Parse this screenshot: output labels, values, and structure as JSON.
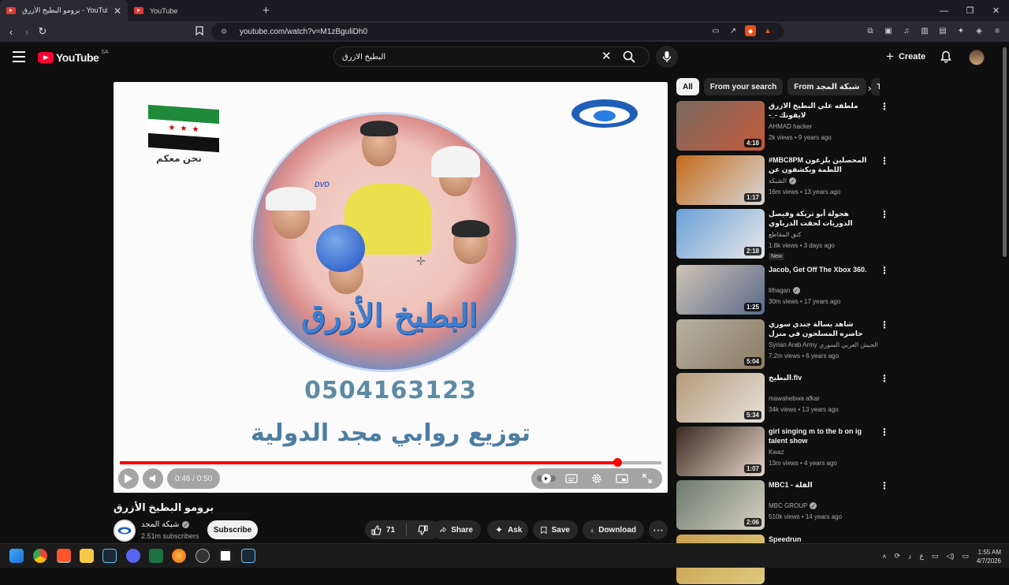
{
  "browser": {
    "tabs": [
      {
        "title": "برومو البطيخ الأزرق - YouTube",
        "active": true
      },
      {
        "title": "YouTube",
        "active": false
      }
    ],
    "new_tab_glyph": "+",
    "url": "youtube.com/watch?v=M1zBguliDh0"
  },
  "yt_header": {
    "logo_text": "YouTube",
    "country_code": "SA",
    "search_query": "البطيخ الازرق",
    "create_label": "Create"
  },
  "player": {
    "flag_caption": "نحن معكم",
    "dvd_label": "DVD",
    "disc_title": "البطيخ الأزرق",
    "phone": "0504163123",
    "distribution": "توزيع روابي مجد الدولية",
    "time": "0:46 / 0:50",
    "progress_fraction": 0.92
  },
  "video": {
    "title": "برومو البطيخ الأزرق",
    "channel": "شبكة المجد",
    "subscribers": "2.51m subscribers",
    "subscribe_label": "Subscribe",
    "likes": "71",
    "share_label": "Share",
    "ask_label": "Ask",
    "save_label": "Save",
    "download_label": "Download"
  },
  "chips": [
    "All",
    "From your search",
    "From شبكة المجد",
    "Tele"
  ],
  "recommendations": [
    {
      "title": "ملطفه علي البطيخ الازرق لايفوتك -_- ههههههههههههههههههه*",
      "channel": "AHMAD hacker",
      "meta": "2k views • 9 years ago",
      "duration": "4:18",
      "verified": false,
      "thumb": [
        "#7a6a60",
        "#c45a3a"
      ]
    },
    {
      "title": "#MBC8PM المحصلين يلزعون اللطمة ويكشفون عن هوياتهم",
      "channel": "الشبكة",
      "meta": "16m views • 13 years ago",
      "duration": "1:17",
      "verified": true,
      "thumb": [
        "#c46a1a",
        "#d8d8d8"
      ]
    },
    {
      "title": "هجولة أبو تريكة وفيصل الدوريات لحقت الدرباوي والنهاية صدمة 😱 هههه",
      "channel": "كنق المقاطع",
      "meta": "1.8k views • 3 days ago",
      "duration": "2:18",
      "verified": false,
      "badge": "New",
      "thumb": [
        "#6aa0d8",
        "#e8e8e8"
      ]
    },
    {
      "title": "Jacob, Get Off The Xbox 360.",
      "channel": "lilhagan",
      "meta": "30m views • 17 years ago",
      "duration": "1:25",
      "verified": true,
      "thumb": [
        "#cfc4b6",
        "#5a6a8a"
      ]
    },
    {
      "title": "شاهد بسالة جندي سوري حاصره المسلحون في منزل معزول واجبرهم على التراجع",
      "channel": "Syrian Arab Army الجيش العربي السوري",
      "meta": "7.2m views • 6 years ago",
      "duration": "5:04",
      "verified": false,
      "thumb": [
        "#b8b0a2",
        "#8a7b62"
      ]
    },
    {
      "title": "البطيخ.flv",
      "channel": "mawahebwa afkar",
      "meta": "34k views • 13 years ago",
      "duration": "5:34",
      "verified": false,
      "thumb": [
        "#b69a7a",
        "#e6e2da"
      ]
    },
    {
      "title": "girl singing m to the b on ig talent show",
      "channel": "Kwaz",
      "meta": "13m views • 4 years ago",
      "duration": "1:07",
      "verified": false,
      "thumb": [
        "#3a2a22",
        "#e8d6c8"
      ]
    },
    {
      "title": "MBC1 - الفلة",
      "channel": "MBC GROUP",
      "meta": "510k views • 14 years ago",
      "duration": "2:06",
      "verified": true,
      "thumb": [
        "#6a7a6a",
        "#d8d2c4"
      ]
    },
    {
      "title": "Speedrun",
      "channel": "",
      "meta": "",
      "duration": "",
      "verified": false,
      "thumb": [
        "#c8a050",
        "#e0c880"
      ]
    }
  ],
  "taskbar": {
    "time": "1:55 AM",
    "date": "4/7/2026",
    "lang": "ع"
  },
  "colors": {
    "accent": "#ff0033",
    "progress": "#ff0000",
    "bg": "#0f0f0f"
  }
}
